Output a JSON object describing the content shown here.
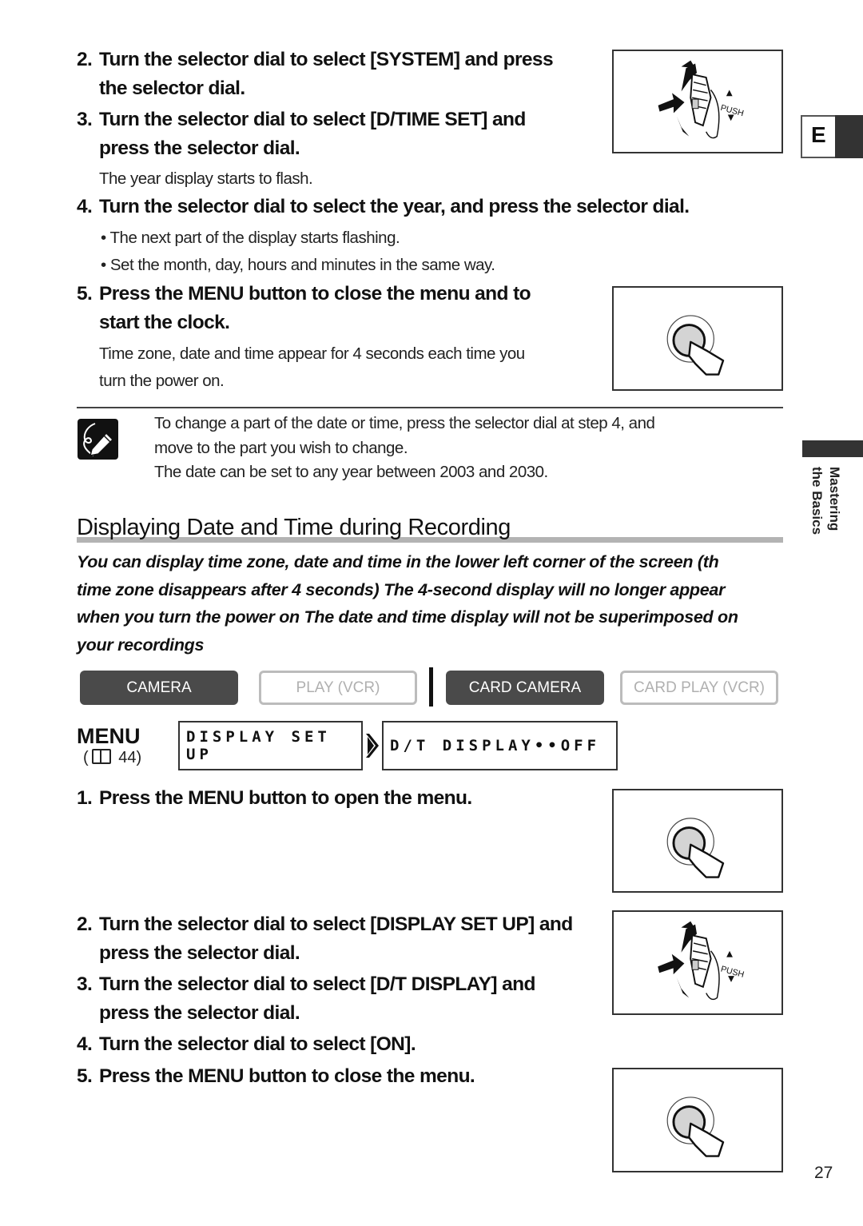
{
  "tab_marker": "E",
  "side_tab": {
    "line1": "Mastering",
    "line2": "the Basics"
  },
  "set_date_steps": [
    {
      "num": "2.",
      "line1": "Turn the selector dial to select [SYSTEM] and press",
      "line2": "the selector dial."
    },
    {
      "num": "3.",
      "line1": "Turn the selector dial to select [D/TIME SET] and",
      "line2": "press the selector dial."
    },
    {
      "note": "The year display starts to flash."
    },
    {
      "num": "4.",
      "line1": "Turn the selector dial to select the year, and press the selector dial."
    },
    {
      "bullets": [
        "The next part of the display starts flashing.",
        "Set the month, day, hours and minutes in the same way."
      ]
    },
    {
      "num": "5.",
      "line1": "Press the MENU button to close the menu and to",
      "line2": "start the clock.",
      "note1": "Time zone, date and time appear for 4 seconds each time you",
      "note2": "turn the power on."
    }
  ],
  "tip_note": {
    "icon": "pencil-note-icon",
    "lines": [
      "To change a part of the date or time, press the selector dial at step 4, and",
      "move to the part you wish to change.",
      "The date can be set to any year between 2003 and 2030."
    ]
  },
  "section": {
    "title": "Displaying Date and Time during Recording",
    "intro_lines": [
      "You can display time zone, date and time in the lower left corner of the screen (th",
      "time zone disappears after 4 seconds)  The 4-second display will no longer appear",
      "when you turn the power on  The date and time display will not be superimposed on",
      "your recordings"
    ]
  },
  "modes": [
    {
      "label": "CAMERA",
      "active": true
    },
    {
      "label": "PLAY (VCR)",
      "active": false
    },
    {
      "label": "CARD CAMERA",
      "active": true
    },
    {
      "label": "CARD PLAY (VCR)",
      "active": false
    }
  ],
  "menu_path": {
    "menu_label": "MENU",
    "page_ref": "( ☐ 44)",
    "page_ref_num": "44",
    "item1": "DISPLAY SET UP",
    "item2": "D/T DISPLAY••OFF"
  },
  "display_steps": [
    {
      "num": "1.",
      "text": "Press the MENU button to open the menu."
    },
    {
      "num": "2.",
      "line1": "Turn the selector dial to select [DISPLAY SET UP] and",
      "line2": "press the selector dial."
    },
    {
      "num": "3.",
      "line1": "Turn the selector dial to select [D/T DISPLAY] and",
      "line2": "press the selector dial."
    },
    {
      "num": "4.",
      "text": "Turn the selector dial to select [ON]."
    },
    {
      "num": "5.",
      "text": "Press the MENU button to close the menu."
    }
  ],
  "figures": {
    "dial_label": "PUSH"
  },
  "page_number": "27"
}
